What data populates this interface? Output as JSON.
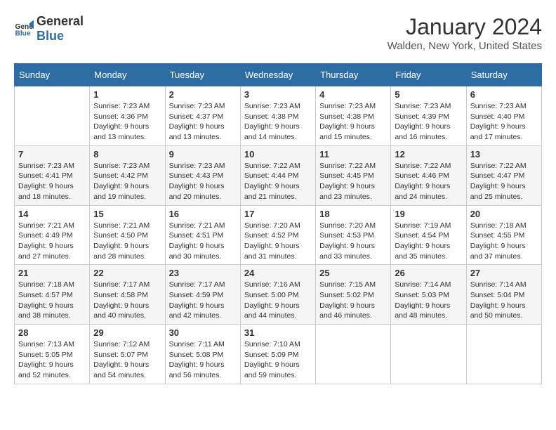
{
  "header": {
    "logo_general": "General",
    "logo_blue": "Blue",
    "month_title": "January 2024",
    "location": "Walden, New York, United States"
  },
  "days_of_week": [
    "Sunday",
    "Monday",
    "Tuesday",
    "Wednesday",
    "Thursday",
    "Friday",
    "Saturday"
  ],
  "weeks": [
    [
      {
        "day": "",
        "info": ""
      },
      {
        "day": "1",
        "info": "Sunrise: 7:23 AM\nSunset: 4:36 PM\nDaylight: 9 hours\nand 13 minutes."
      },
      {
        "day": "2",
        "info": "Sunrise: 7:23 AM\nSunset: 4:37 PM\nDaylight: 9 hours\nand 13 minutes."
      },
      {
        "day": "3",
        "info": "Sunrise: 7:23 AM\nSunset: 4:38 PM\nDaylight: 9 hours\nand 14 minutes."
      },
      {
        "day": "4",
        "info": "Sunrise: 7:23 AM\nSunset: 4:38 PM\nDaylight: 9 hours\nand 15 minutes."
      },
      {
        "day": "5",
        "info": "Sunrise: 7:23 AM\nSunset: 4:39 PM\nDaylight: 9 hours\nand 16 minutes."
      },
      {
        "day": "6",
        "info": "Sunrise: 7:23 AM\nSunset: 4:40 PM\nDaylight: 9 hours\nand 17 minutes."
      }
    ],
    [
      {
        "day": "7",
        "info": "Sunrise: 7:23 AM\nSunset: 4:41 PM\nDaylight: 9 hours\nand 18 minutes."
      },
      {
        "day": "8",
        "info": "Sunrise: 7:23 AM\nSunset: 4:42 PM\nDaylight: 9 hours\nand 19 minutes."
      },
      {
        "day": "9",
        "info": "Sunrise: 7:23 AM\nSunset: 4:43 PM\nDaylight: 9 hours\nand 20 minutes."
      },
      {
        "day": "10",
        "info": "Sunrise: 7:22 AM\nSunset: 4:44 PM\nDaylight: 9 hours\nand 21 minutes."
      },
      {
        "day": "11",
        "info": "Sunrise: 7:22 AM\nSunset: 4:45 PM\nDaylight: 9 hours\nand 23 minutes."
      },
      {
        "day": "12",
        "info": "Sunrise: 7:22 AM\nSunset: 4:46 PM\nDaylight: 9 hours\nand 24 minutes."
      },
      {
        "day": "13",
        "info": "Sunrise: 7:22 AM\nSunset: 4:47 PM\nDaylight: 9 hours\nand 25 minutes."
      }
    ],
    [
      {
        "day": "14",
        "info": "Sunrise: 7:21 AM\nSunset: 4:49 PM\nDaylight: 9 hours\nand 27 minutes."
      },
      {
        "day": "15",
        "info": "Sunrise: 7:21 AM\nSunset: 4:50 PM\nDaylight: 9 hours\nand 28 minutes."
      },
      {
        "day": "16",
        "info": "Sunrise: 7:21 AM\nSunset: 4:51 PM\nDaylight: 9 hours\nand 30 minutes."
      },
      {
        "day": "17",
        "info": "Sunrise: 7:20 AM\nSunset: 4:52 PM\nDaylight: 9 hours\nand 31 minutes."
      },
      {
        "day": "18",
        "info": "Sunrise: 7:20 AM\nSunset: 4:53 PM\nDaylight: 9 hours\nand 33 minutes."
      },
      {
        "day": "19",
        "info": "Sunrise: 7:19 AM\nSunset: 4:54 PM\nDaylight: 9 hours\nand 35 minutes."
      },
      {
        "day": "20",
        "info": "Sunrise: 7:18 AM\nSunset: 4:55 PM\nDaylight: 9 hours\nand 37 minutes."
      }
    ],
    [
      {
        "day": "21",
        "info": "Sunrise: 7:18 AM\nSunset: 4:57 PM\nDaylight: 9 hours\nand 38 minutes."
      },
      {
        "day": "22",
        "info": "Sunrise: 7:17 AM\nSunset: 4:58 PM\nDaylight: 9 hours\nand 40 minutes."
      },
      {
        "day": "23",
        "info": "Sunrise: 7:17 AM\nSunset: 4:59 PM\nDaylight: 9 hours\nand 42 minutes."
      },
      {
        "day": "24",
        "info": "Sunrise: 7:16 AM\nSunset: 5:00 PM\nDaylight: 9 hours\nand 44 minutes."
      },
      {
        "day": "25",
        "info": "Sunrise: 7:15 AM\nSunset: 5:02 PM\nDaylight: 9 hours\nand 46 minutes."
      },
      {
        "day": "26",
        "info": "Sunrise: 7:14 AM\nSunset: 5:03 PM\nDaylight: 9 hours\nand 48 minutes."
      },
      {
        "day": "27",
        "info": "Sunrise: 7:14 AM\nSunset: 5:04 PM\nDaylight: 9 hours\nand 50 minutes."
      }
    ],
    [
      {
        "day": "28",
        "info": "Sunrise: 7:13 AM\nSunset: 5:05 PM\nDaylight: 9 hours\nand 52 minutes."
      },
      {
        "day": "29",
        "info": "Sunrise: 7:12 AM\nSunset: 5:07 PM\nDaylight: 9 hours\nand 54 minutes."
      },
      {
        "day": "30",
        "info": "Sunrise: 7:11 AM\nSunset: 5:08 PM\nDaylight: 9 hours\nand 56 minutes."
      },
      {
        "day": "31",
        "info": "Sunrise: 7:10 AM\nSunset: 5:09 PM\nDaylight: 9 hours\nand 59 minutes."
      },
      {
        "day": "",
        "info": ""
      },
      {
        "day": "",
        "info": ""
      },
      {
        "day": "",
        "info": ""
      }
    ]
  ]
}
